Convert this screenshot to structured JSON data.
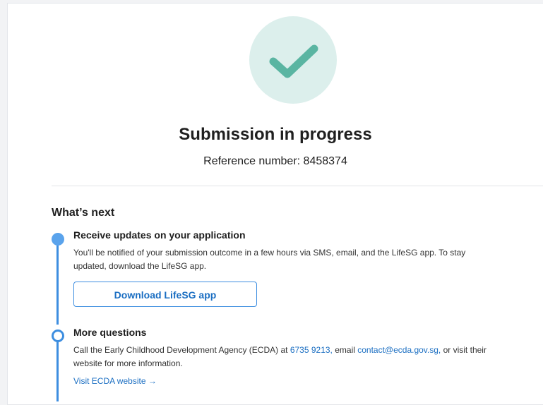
{
  "status": {
    "title": "Submission in progress",
    "reference_label": "Reference number: ",
    "reference_number": "8458374",
    "icon": "check-icon",
    "accent_color": "#5ab5a2"
  },
  "next_steps": {
    "heading": "What’s next",
    "steps": [
      {
        "title": "Receive updates on your application",
        "text_line_1": "You'll be notified of your submission outcome in a few hours via SMS, email, and the LifeSG app. To stay",
        "text_line_2": "updated, download the LifeSG app.",
        "button_label": "Download LifeSG app"
      },
      {
        "title": "More questions",
        "text_before_phone": "Call the Early Childhood Development Agency (ECDA) at ",
        "phone": "6735 9213,",
        "text_before_email": " email ",
        "email": "contact@ecda.gov.sg,",
        "text_after_email": " or visit their",
        "text_line_2": "website for more information.",
        "link_label": "Visit ECDA website →"
      }
    ]
  },
  "colors": {
    "timeline": "#3d8ee0",
    "link": "#1a6ec2",
    "check_bg": "#dcefec"
  }
}
